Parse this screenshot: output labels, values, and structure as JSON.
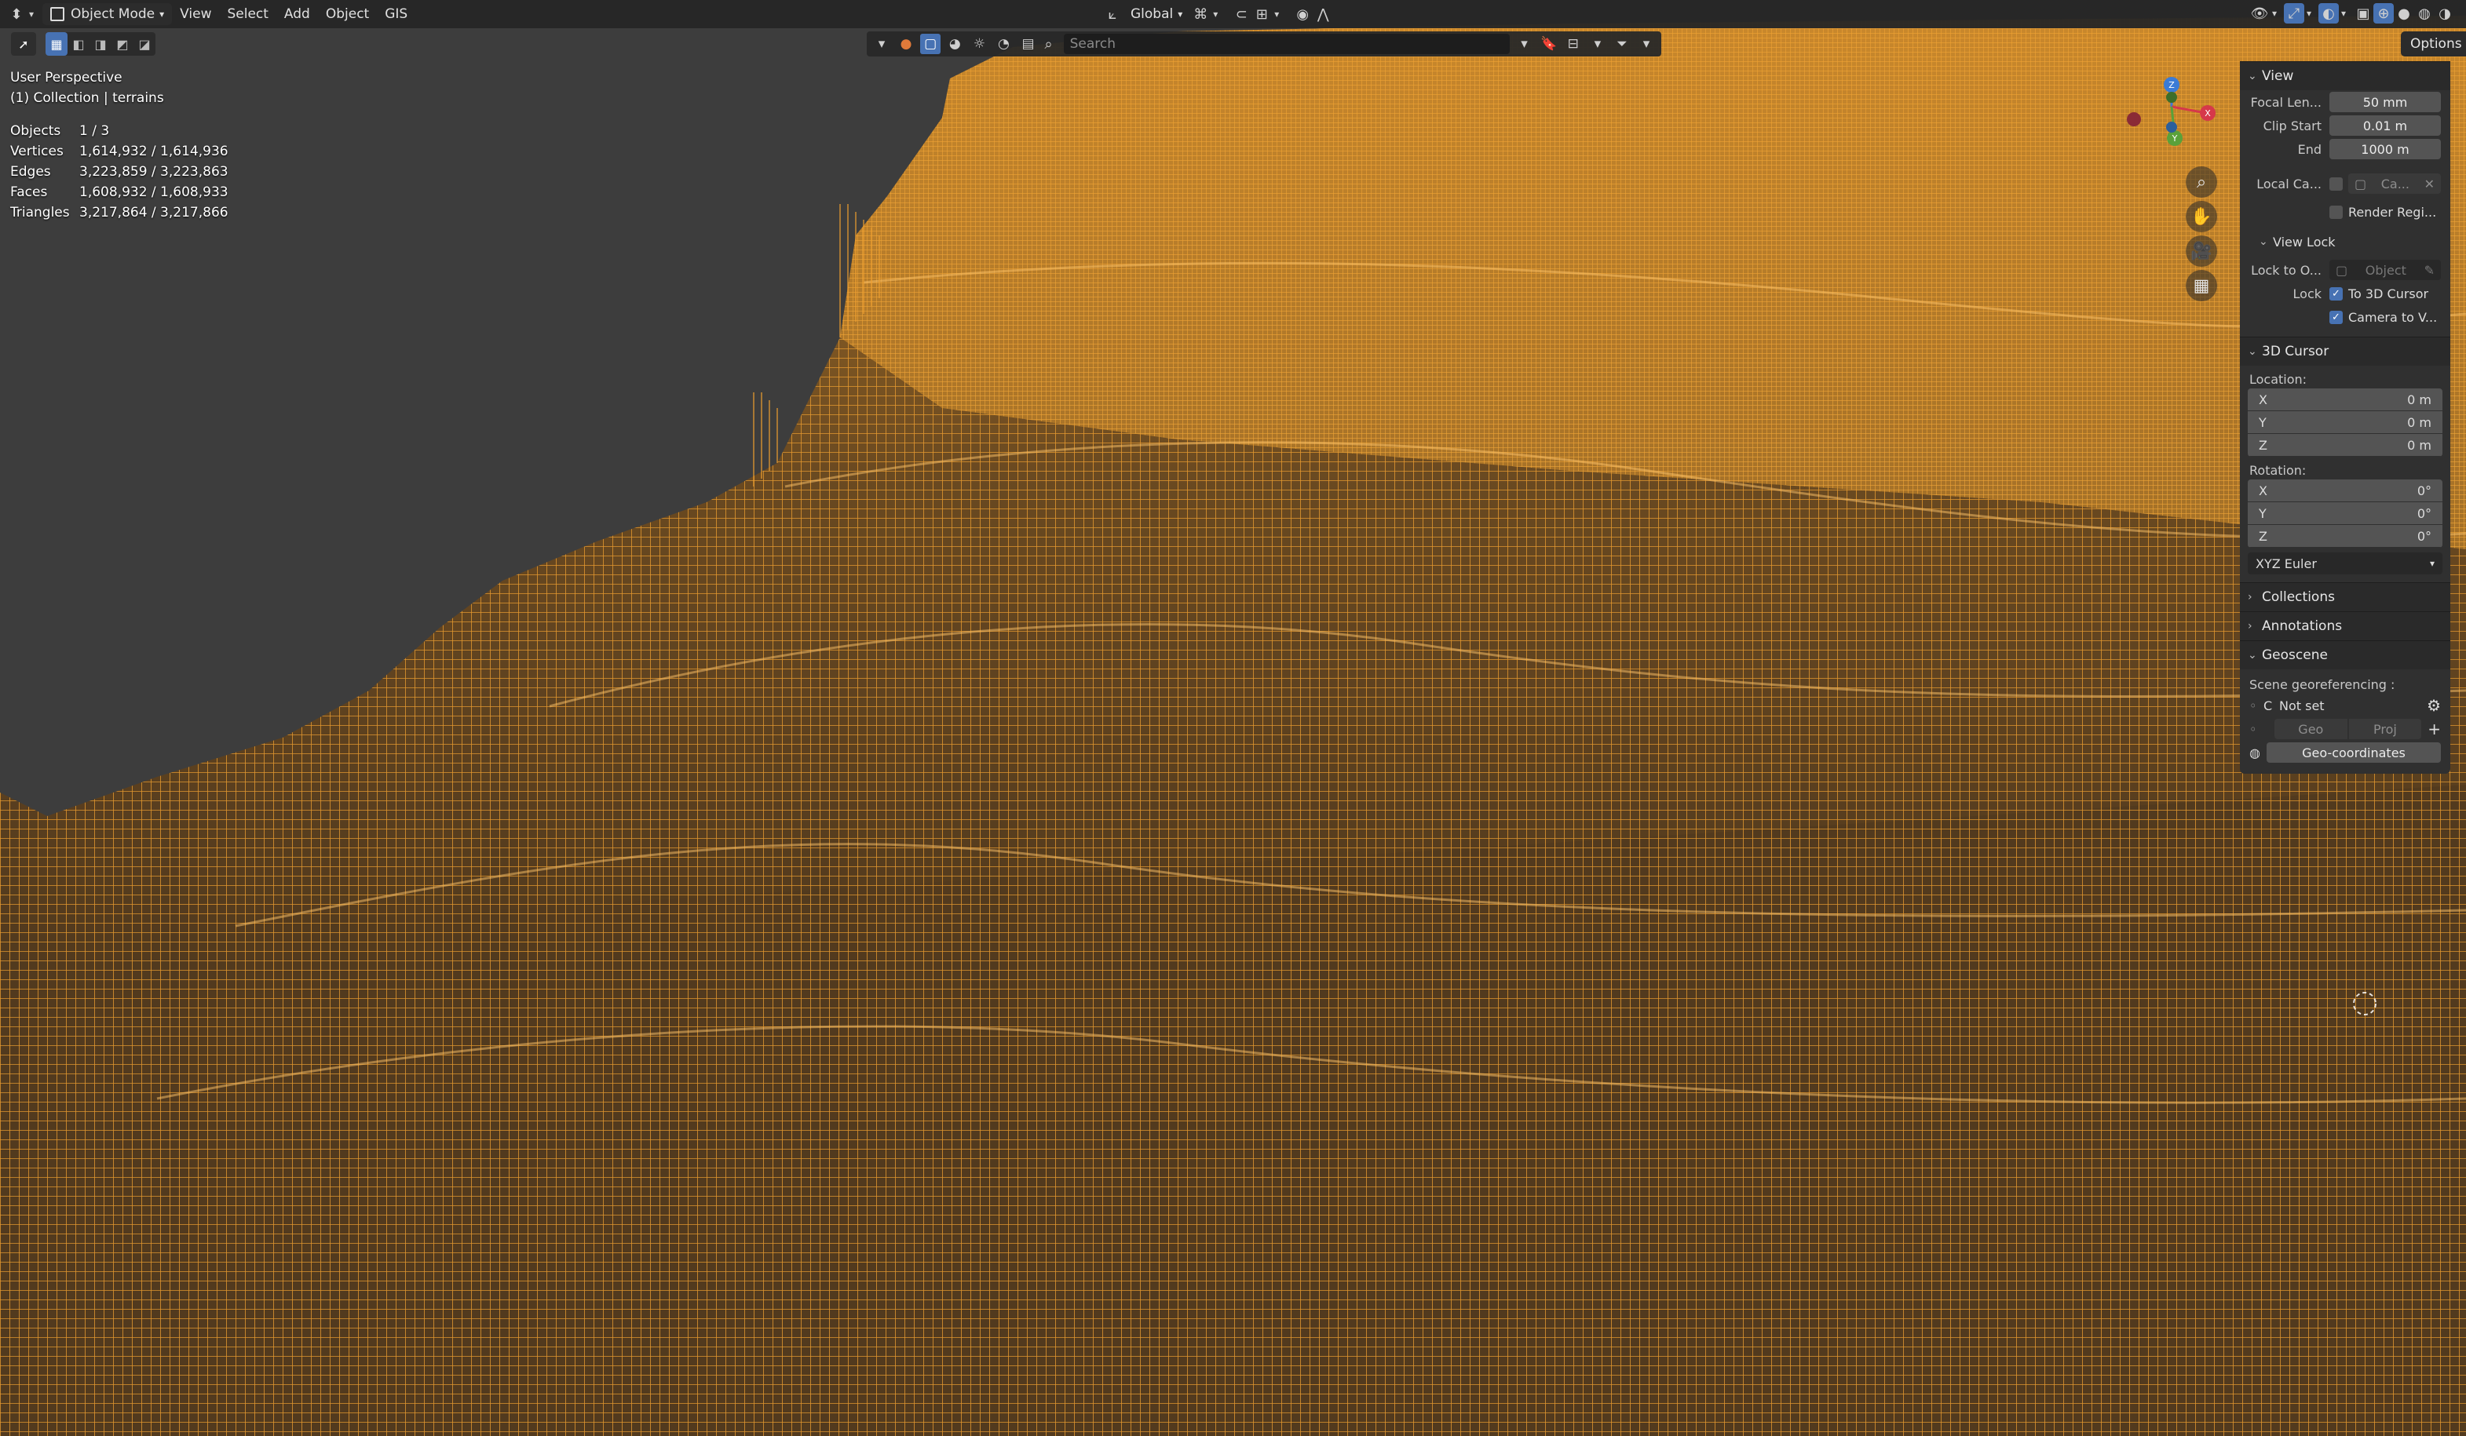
{
  "header": {
    "editor_icon": "3d-viewport-icon",
    "mode": "Object Mode",
    "menus": [
      "View",
      "Select",
      "Add",
      "Object",
      "GIS"
    ],
    "transform_orientation": "Global"
  },
  "search": {
    "placeholder": "Search"
  },
  "overlay": {
    "view_name": "User Perspective",
    "collection": "(1) Collection | terrains",
    "stats": [
      {
        "label": "Objects",
        "value": "1 / 3"
      },
      {
        "label": "Vertices",
        "value": "1,614,932 / 1,614,936"
      },
      {
        "label": "Edges",
        "value": "3,223,859 / 3,223,863"
      },
      {
        "label": "Faces",
        "value": "1,608,932 / 1,608,933"
      },
      {
        "label": "Triangles",
        "value": "3,217,864 / 3,217,866"
      }
    ]
  },
  "options_label": "Options",
  "gizmo": {
    "x": "X",
    "y": "Y",
    "z": "Z"
  },
  "npanel": {
    "view": {
      "title": "View",
      "focal_label": "Focal Len...",
      "focal_value": "50 mm",
      "clip_start_label": "Clip Start",
      "clip_start_value": "0.01 m",
      "end_label": "End",
      "end_value": "1000 m",
      "local_camera_label": "Local Ca...",
      "local_camera_value": "Ca...",
      "render_region_label": "Render Regi...",
      "view_lock_title": "View Lock",
      "lock_to_label": "Lock to O...",
      "lock_to_placeholder": "Object",
      "lock_label": "Lock",
      "lock_cursor_label": "To 3D Cursor",
      "lock_camera_label": "Camera to V..."
    },
    "cursor": {
      "title": "3D Cursor",
      "location_label": "Location:",
      "location": [
        {
          "axis": "X",
          "value": "0 m"
        },
        {
          "axis": "Y",
          "value": "0 m"
        },
        {
          "axis": "Z",
          "value": "0 m"
        }
      ],
      "rotation_label": "Rotation:",
      "rotation": [
        {
          "axis": "X",
          "value": "0°"
        },
        {
          "axis": "Y",
          "value": "0°"
        },
        {
          "axis": "Z",
          "value": "0°"
        }
      ],
      "rotation_mode": "XYZ Euler"
    },
    "collections_title": "Collections",
    "annotations_title": "Annotations",
    "geoscene": {
      "title": "Geoscene",
      "georef_label": "Scene georeferencing :",
      "crs_prefix": "C",
      "crs_value": "Not set",
      "geo_button": "Geo",
      "proj_button": "Proj",
      "geocoords_button": "Geo-coordinates"
    }
  },
  "colors": {
    "wire": "#f0a030",
    "background": "#3d3d3d",
    "accent": "#4772b3"
  }
}
